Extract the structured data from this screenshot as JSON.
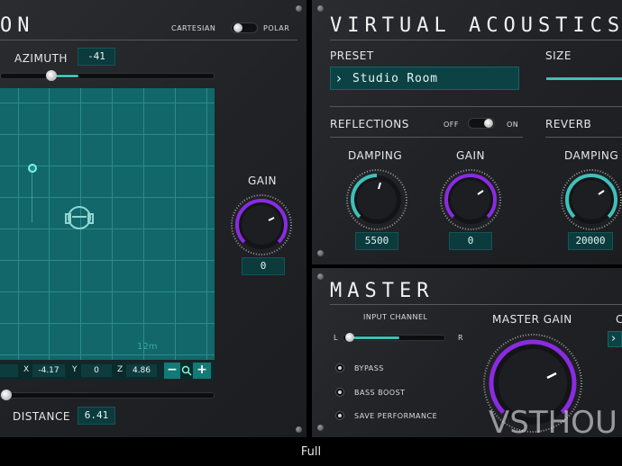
{
  "left_panel": {
    "title_fragment": "ON",
    "mode_toggle": {
      "left_label": "CARTESIAN",
      "right_label": "POLAR"
    },
    "azimuth": {
      "label": "AZIMUTH",
      "value": "-41"
    },
    "grid": {
      "scale_label": "12m"
    },
    "coords": {
      "x_label": "X",
      "x_value": "-4.17",
      "y_label": "Y",
      "y_value": "0",
      "z_label": "Z",
      "z_value": "4.86"
    },
    "zoom": {
      "minus": "−",
      "plus": "+"
    },
    "distance": {
      "label": "DISTANCE",
      "value": "6.41"
    },
    "gain": {
      "label": "GAIN",
      "value": "0"
    }
  },
  "virtual_acoustics": {
    "title": "VIRTUAL ACOUSTICS",
    "preset_label": "PRESET",
    "preset_value": "Studio Room",
    "size_label": "SIZE",
    "reflections": {
      "label": "REFLECTIONS",
      "off": "OFF",
      "on": "ON",
      "damping_label": "DAMPING",
      "damping_value": "5500",
      "gain_label": "GAIN",
      "gain_value": "0"
    },
    "reverb": {
      "label": "REVERB",
      "damping_label": "DAMPING",
      "damping_value": "20000"
    }
  },
  "master": {
    "title": "MASTER",
    "input_channel_label": "INPUT CHANNEL",
    "l_label": "L",
    "r_label": "R",
    "options": [
      "BYPASS",
      "BASS BOOST",
      "SAVE PERFORMANCE"
    ],
    "master_gain_label": "MASTER GAIN",
    "right_fragment": "C",
    "watermark": "VSTHOU"
  },
  "footer": {
    "caption": "Full"
  },
  "colors": {
    "accent": "#3fc0b8",
    "knob_purple": "#8a2be2",
    "grid_teal": "#116769"
  }
}
